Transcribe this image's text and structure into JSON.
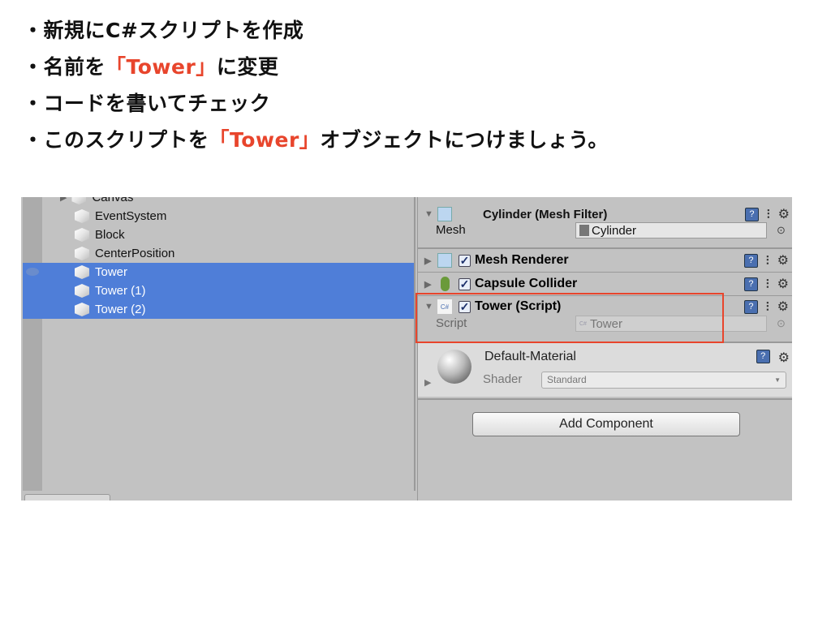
{
  "bullets": [
    {
      "text": "・新規にC#スクリプトを作成"
    },
    {
      "pre": "・名前を",
      "highlight": "「Tower」",
      "post": "に変更"
    },
    {
      "text": "・コードを書いてチェック"
    },
    {
      "pre": "・このスクリプトを",
      "highlight": "「Tower」",
      "post": "オブジェクトにつけましょう。"
    }
  ],
  "highlight_color": "#e8452c",
  "hierarchy": {
    "items": [
      {
        "label": "Canvas",
        "selected": false
      },
      {
        "label": "EventSystem",
        "selected": false
      },
      {
        "label": "Block",
        "selected": false
      },
      {
        "label": "CenterPosition",
        "selected": false
      },
      {
        "label": "Tower",
        "selected": true
      },
      {
        "label": "Tower (1)",
        "selected": true
      },
      {
        "label": "Tower (2)",
        "selected": true
      }
    ],
    "selection_color": "#4f7ed8"
  },
  "inspector": {
    "mesh_filter": {
      "title": "Cylinder (Mesh Filter)",
      "field_label": "Mesh",
      "field_value": "Cylinder"
    },
    "mesh_renderer": {
      "title": "Mesh Renderer",
      "enabled": true
    },
    "capsule_collider": {
      "title": "Capsule Collider",
      "enabled": true
    },
    "tower_script": {
      "title": "Tower (Script)",
      "enabled": true,
      "field_label": "Script",
      "field_value": "Tower",
      "icon_text": "C#"
    },
    "material": {
      "name": "Default-Material",
      "shader_label": "Shader",
      "shader_value": "Standard"
    },
    "add_component": "Add Component",
    "help_glyph": "?",
    "checkmark": "✓"
  }
}
